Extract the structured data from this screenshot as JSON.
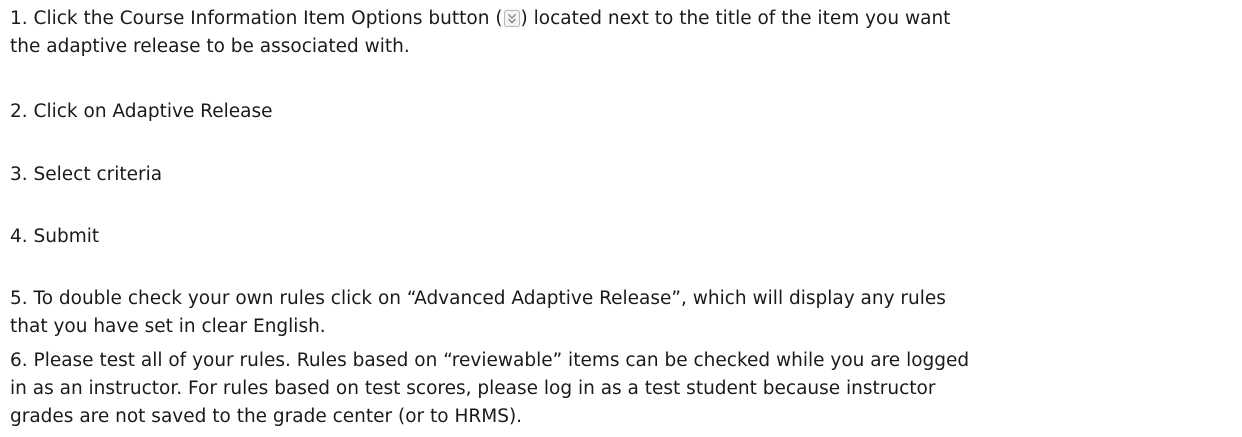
{
  "steps": [
    {
      "lines": [
        {
          "before": "1. Click the Course Information Item Options button (",
          "icon": "double-chevron-down-icon",
          "after": ") located next to the title of the item you want"
        },
        "the adaptive release to be associated with."
      ]
    },
    {
      "lines": [
        "2. Click on Adaptive Release"
      ]
    },
    {
      "lines": [
        "3. Select criteria"
      ]
    },
    {
      "lines": [
        "4. Submit"
      ]
    },
    {
      "lines": [
        "5. To double check your own rules click on “Advanced Adaptive Release”, which will display any rules",
        "that you have set in clear English."
      ]
    },
    {
      "lines": [
        "6. Please test all of your rules. Rules based on “reviewable” items can be checked while you are logged",
        "in as an instructor. For rules based on test scores, please log in as a test student because instructor",
        "grades are not saved to the grade center (or to HRMS)."
      ]
    }
  ]
}
